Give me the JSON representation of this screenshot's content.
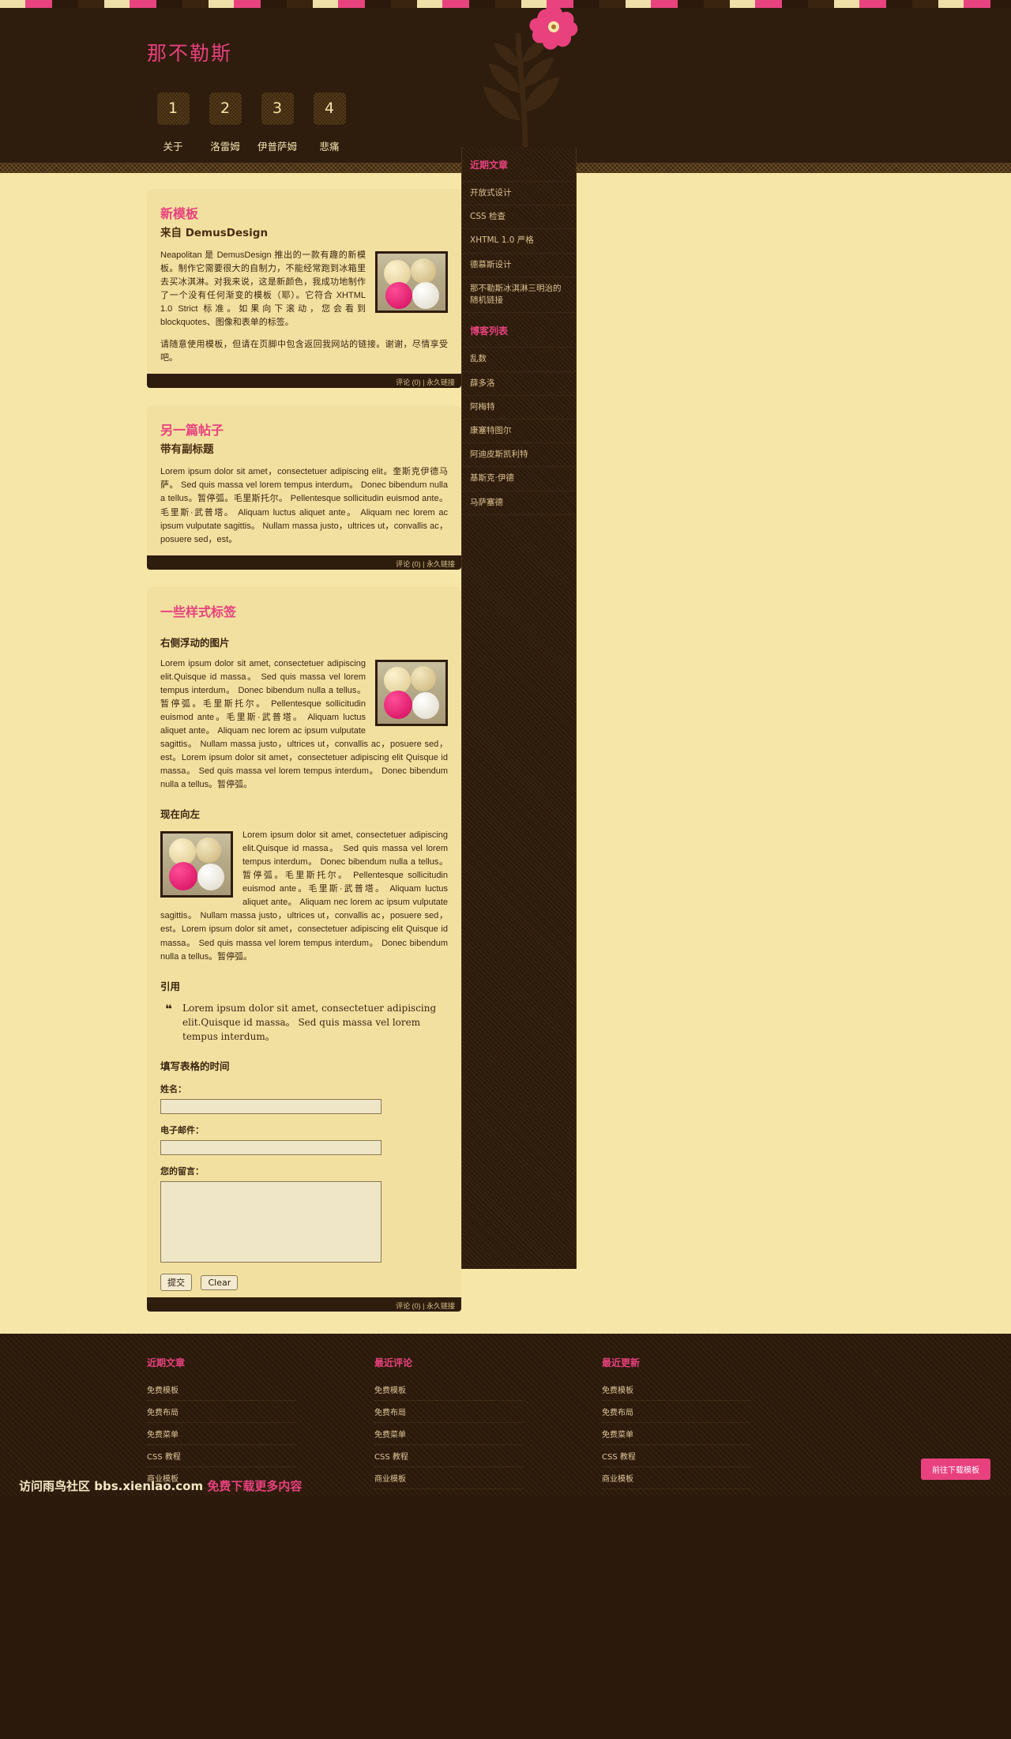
{
  "header": {
    "site_title": "那不勒斯",
    "nav": [
      {
        "num": "1",
        "label": "关于"
      },
      {
        "num": "2",
        "label": "洛雷姆"
      },
      {
        "num": "3",
        "label": "伊普萨姆"
      },
      {
        "num": "4",
        "label": "悲痛"
      }
    ],
    "flower_icon": "flower-icon"
  },
  "posts": [
    {
      "title": "新模板",
      "subtitle": "来自 DemusDesign",
      "paragraphs": [
        "Neapolitan 是 DemusDesign 推出的一款有趣的新模板。制作它需要很大的自制力，不能经常跑到冰箱里去买冰淇淋。对我来说，这是新颜色，我成功地制作了一个没有任何渐变的模板（耶）。它符合 XHTML 1.0 Strict 标准。如果向下滚动，您会看到 blockquotes、图像和表单的标签。",
        "请随意使用模板，但请在页脚中包含返回我网站的链接。谢谢，尽情享受吧。"
      ],
      "meta_comments": "评论 (0)",
      "meta_sep": "|",
      "meta_permalink": "永久链接"
    },
    {
      "title": "另一篇帖子",
      "subtitle": "带有副标题",
      "paragraphs": [
        "Lorem ipsum dolor sit amet，consectetuer adipiscing elit。奎斯克伊德马萨。 Sed quis massa vel lorem tempus interdum。 Donec bibendum nulla a tellus。暂停弧。毛里斯托尔。 Pellentesque sollicitudin euismod ante。毛里斯·武普塔。 Aliquam luctus aliquet ante。 Aliquam nec lorem ac ipsum vulputate sagittis。 Nullam massa justo，ultrices ut，convallis ac，posuere sed，est。"
      ],
      "meta_comments": "评论 (0)",
      "meta_sep": "|",
      "meta_permalink": "永久链接"
    },
    {
      "title": "一些样式标签",
      "heading_right": "右侧浮动的图片",
      "para_right": "Lorem ipsum dolor sit amet, consectetuer adipiscing elit.Quisque id massa。 Sed quis massa vel lorem tempus interdum。 Donec bibendum nulla a tellus。暂停弧。毛里斯托尔。 Pellentesque sollicitudin euismod ante。毛里斯·武普塔。 Aliquam luctus aliquet ante。 Aliquam nec lorem ac ipsum vulputate sagittis。 Nullam massa justo，ultrices ut，convallis ac，posuere sed，est。Lorem ipsum dolor sit amet，consectetuer adipiscing elit Quisque id massa。 Sed quis massa vel lorem tempus interdum。 Donec bibendum nulla a tellus。暂停弧。",
      "heading_left": "现在向左",
      "para_left": "Lorem ipsum dolor sit amet, consectetuer adipiscing elit.Quisque id massa。 Sed quis massa vel lorem tempus interdum。 Donec bibendum nulla a tellus。暂停弧。毛里斯托尔。 Pellentesque sollicitudin euismod ante。毛里斯·武普塔。 Aliquam luctus aliquet ante。 Aliquam nec lorem ac ipsum vulputate sagittis。 Nullam massa justo，ultrices ut，convallis ac，posuere sed，est。Lorem ipsum dolor sit amet，consectetuer adipiscing elit Quisque id massa。 Sed quis massa vel lorem tempus interdum。 Donec bibendum nulla a tellus。暂停弧。",
      "heading_quote": "引用",
      "quote_mark": "❝",
      "quote_text": "Lorem ipsum dolor sit amet, consectetuer adipiscing elit.Quisque id massa。 Sed quis massa vel lorem tempus interdum。",
      "heading_form": "填写表格的时间",
      "form": {
        "name_label": "姓名：",
        "name_value": "",
        "email_label": "电子邮件：",
        "email_value": "",
        "message_label": "您的留言：",
        "message_value": "",
        "submit_label": "提交",
        "clear_label": "Clear"
      },
      "meta_comments": "评论 (0)",
      "meta_sep": "|",
      "meta_permalink": "永久链接"
    }
  ],
  "sidebar": {
    "sections": [
      {
        "title": "近期文章",
        "items": [
          "开放式设计",
          "CSS 检查",
          "XHTML 1.0 严格",
          "德慕斯设计",
          "那不勒斯冰淇淋三明治的随机链接"
        ]
      },
      {
        "title": "博客列表",
        "items": [
          "乱数",
          "薛多洛",
          "阿梅特",
          "康塞特图尔",
          "阿迪皮斯凯利特",
          "基斯克·伊德",
          "马萨塞德"
        ]
      }
    ]
  },
  "footer": {
    "columns": [
      {
        "title": "近期文章",
        "items": [
          "免费模板",
          "免费布局",
          "免费菜单",
          "CSS 教程",
          "商业模板"
        ]
      },
      {
        "title": "最近评论",
        "items": [
          "免费模板",
          "免费布局",
          "免费菜单",
          "CSS 教程",
          "商业模板"
        ]
      },
      {
        "title": "最近更新",
        "items": [
          "免费模板",
          "免费布局",
          "免费菜单",
          "CSS 教程",
          "商业模板"
        ]
      }
    ],
    "download_label": "前往下载模板",
    "watermark_a": "访问雨鸟社区 bbs.xienlao.com",
    "watermark_b": "免费下载更多内容"
  },
  "colors": {
    "accent_pink": "#e8417e",
    "bg_dark": "#2b1a0c",
    "bg_cream": "#f6e7a8"
  }
}
